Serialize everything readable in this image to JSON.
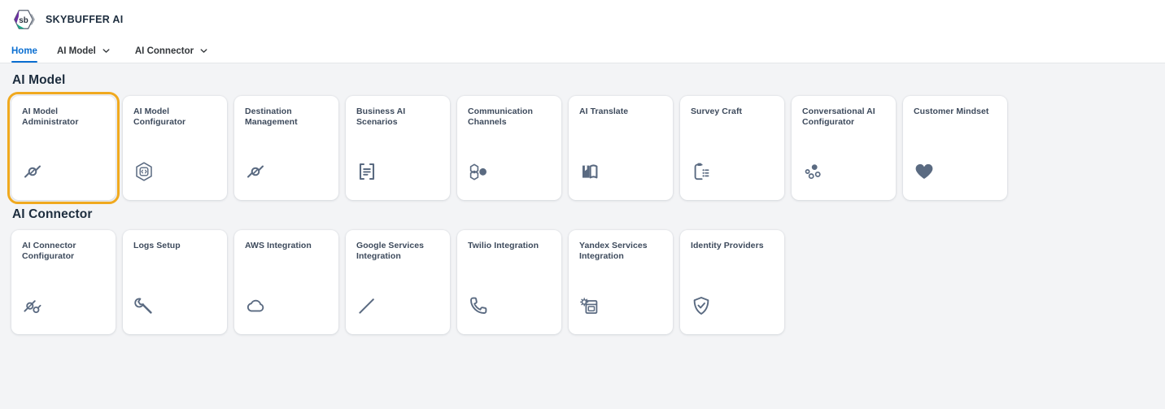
{
  "header": {
    "logo_icon": "skybuffer-hexagon-logo",
    "logo_text": "sb",
    "brand_name": "SKYBUFFER AI"
  },
  "nav": {
    "items": [
      {
        "label": "Home",
        "active": true,
        "has_chevron": false,
        "icon": ""
      },
      {
        "label": "AI Model",
        "active": false,
        "has_chevron": true,
        "icon": "chevron-down-icon"
      },
      {
        "label": "AI Connector",
        "active": false,
        "has_chevron": true,
        "icon": "chevron-down-icon"
      }
    ]
  },
  "colors": {
    "accent_link": "#0a6ed1",
    "focus_ring": "#f0a91f",
    "icon": "#5a6a81",
    "title": "#1d2d3e",
    "page_background": "#f3f4f6",
    "tile_background": "#ffffff"
  },
  "groups": [
    {
      "title": "AI Model",
      "tiles": [
        {
          "title": "AI Model Administrator",
          "icon": "link-node-icon",
          "focused": true
        },
        {
          "title": "AI Model Configurator",
          "icon": "hexagon-code-icon",
          "focused": false
        },
        {
          "title": "Destination Management",
          "icon": "link-node-icon",
          "focused": false
        },
        {
          "title": "Business AI Scenarios",
          "icon": "form-document-icon",
          "focused": false
        },
        {
          "title": "Communication Channels",
          "icon": "hexagon-nodes-icon",
          "focused": false
        },
        {
          "title": "AI Translate",
          "icon": "open-book-icon",
          "focused": false
        },
        {
          "title": "Survey Craft",
          "icon": "clipboard-list-icon",
          "focused": false
        },
        {
          "title": "Conversational AI Configurator",
          "icon": "dot-cluster-icon",
          "focused": false
        },
        {
          "title": "Customer Mindset",
          "icon": "heart-icon",
          "focused": false
        }
      ]
    },
    {
      "title": "AI Connector",
      "tiles": [
        {
          "title": "AI Connector Configurator",
          "icon": "plug-connector-icon",
          "focused": false
        },
        {
          "title": "Logs Setup",
          "icon": "wrench-icon",
          "focused": false
        },
        {
          "title": "AWS Integration",
          "icon": "cloud-icon",
          "focused": false
        },
        {
          "title": "Google Services Integration",
          "icon": "diagonal-line-icon",
          "focused": false
        },
        {
          "title": "Twilio Integration",
          "icon": "phone-icon",
          "focused": false
        },
        {
          "title": "Yandex Services Integration",
          "icon": "document-gear-icon",
          "focused": false
        },
        {
          "title": "Identity Providers",
          "icon": "shield-check-icon",
          "focused": false
        }
      ]
    }
  ]
}
